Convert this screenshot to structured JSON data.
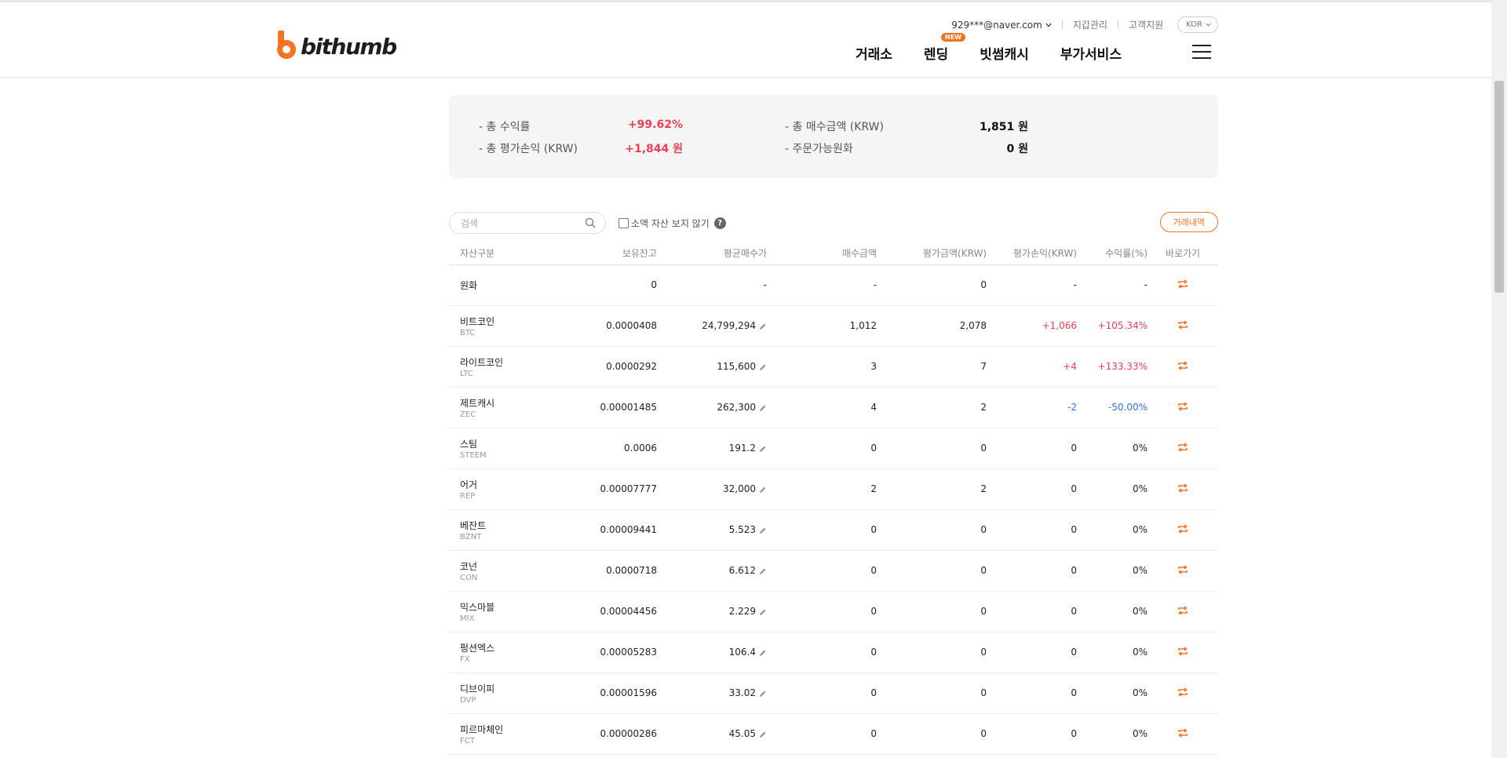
{
  "header": {
    "logo_text": "bithumb",
    "user_email": "929***@naver.com",
    "wallet_link": "지갑관리",
    "support_link": "고객지원",
    "language": "KOR",
    "nav": [
      {
        "label": "거래소"
      },
      {
        "label": "렌딩",
        "badge": "NEW"
      },
      {
        "label": "빗썸캐시"
      },
      {
        "label": "부가서비스"
      }
    ]
  },
  "summary": {
    "total_return_label": "- 총 수익률",
    "total_return_value": "+99.62%",
    "total_pnl_label": "- 총 평가손익 (KRW)",
    "total_pnl_value": "+1,844 원",
    "total_buy_label": "- 총 매수금액 (KRW)",
    "total_buy_value": "1,851 원",
    "available_label": "- 주문가능원화",
    "available_value": "0 원"
  },
  "toolbar": {
    "search_placeholder": "검색",
    "hide_small_label": "소액 자산 보지 않기",
    "help": "?",
    "history_button": "거래내역"
  },
  "table": {
    "headers": [
      "자산구분",
      "보유잔고",
      "평균매수가",
      "매수금액",
      "평가금액(KRW)",
      "평가손익(KRW)",
      "수익률(%)",
      "바로가기"
    ],
    "rows": [
      {
        "name": "원화",
        "symbol": "",
        "balance": "0",
        "avg_price": "-",
        "buy_amount": "-",
        "eval_amount": "0",
        "pnl": "-",
        "rate": "-",
        "trend": "flat",
        "editable": false
      },
      {
        "name": "비트코인",
        "symbol": "BTC",
        "balance": "0.0000408",
        "avg_price": "24,799,294",
        "buy_amount": "1,012",
        "eval_amount": "2,078",
        "pnl": "+1,066",
        "rate": "+105.34%",
        "trend": "up",
        "editable": true
      },
      {
        "name": "라이트코인",
        "symbol": "LTC",
        "balance": "0.0000292",
        "avg_price": "115,600",
        "buy_amount": "3",
        "eval_amount": "7",
        "pnl": "+4",
        "rate": "+133.33%",
        "trend": "up",
        "editable": true
      },
      {
        "name": "제트캐시",
        "symbol": "ZEC",
        "balance": "0.00001485",
        "avg_price": "262,300",
        "buy_amount": "4",
        "eval_amount": "2",
        "pnl": "-2",
        "rate": "-50.00%",
        "trend": "down",
        "editable": true
      },
      {
        "name": "스팀",
        "symbol": "STEEM",
        "balance": "0.0006",
        "avg_price": "191.2",
        "buy_amount": "0",
        "eval_amount": "0",
        "pnl": "0",
        "rate": "0%",
        "trend": "flat",
        "editable": true
      },
      {
        "name": "어거",
        "symbol": "REP",
        "balance": "0.00007777",
        "avg_price": "32,000",
        "buy_amount": "2",
        "eval_amount": "2",
        "pnl": "0",
        "rate": "0%",
        "trend": "flat",
        "editable": true
      },
      {
        "name": "베잔트",
        "symbol": "BZNT",
        "balance": "0.00009441",
        "avg_price": "5.523",
        "buy_amount": "0",
        "eval_amount": "0",
        "pnl": "0",
        "rate": "0%",
        "trend": "flat",
        "editable": true
      },
      {
        "name": "코넌",
        "symbol": "CON",
        "balance": "0.0000718",
        "avg_price": "6.612",
        "buy_amount": "0",
        "eval_amount": "0",
        "pnl": "0",
        "rate": "0%",
        "trend": "flat",
        "editable": true
      },
      {
        "name": "믹스마블",
        "symbol": "MIX",
        "balance": "0.00004456",
        "avg_price": "2.229",
        "buy_amount": "0",
        "eval_amount": "0",
        "pnl": "0",
        "rate": "0%",
        "trend": "flat",
        "editable": true
      },
      {
        "name": "펑션엑스",
        "symbol": "FX",
        "balance": "0.00005283",
        "avg_price": "106.4",
        "buy_amount": "0",
        "eval_amount": "0",
        "pnl": "0",
        "rate": "0%",
        "trend": "flat",
        "editable": true
      },
      {
        "name": "디브이피",
        "symbol": "DVP",
        "balance": "0.00001596",
        "avg_price": "33.02",
        "buy_amount": "0",
        "eval_amount": "0",
        "pnl": "0",
        "rate": "0%",
        "trend": "flat",
        "editable": true
      },
      {
        "name": "피르마체인",
        "symbol": "FCT",
        "balance": "0.00000286",
        "avg_price": "45.05",
        "buy_amount": "0",
        "eval_amount": "0",
        "pnl": "0",
        "rate": "0%",
        "trend": "flat",
        "editable": true
      }
    ]
  },
  "colors": {
    "brand_orange": "#f37321",
    "positive_red": "#e84053",
    "negative_blue": "#2f72e5"
  }
}
